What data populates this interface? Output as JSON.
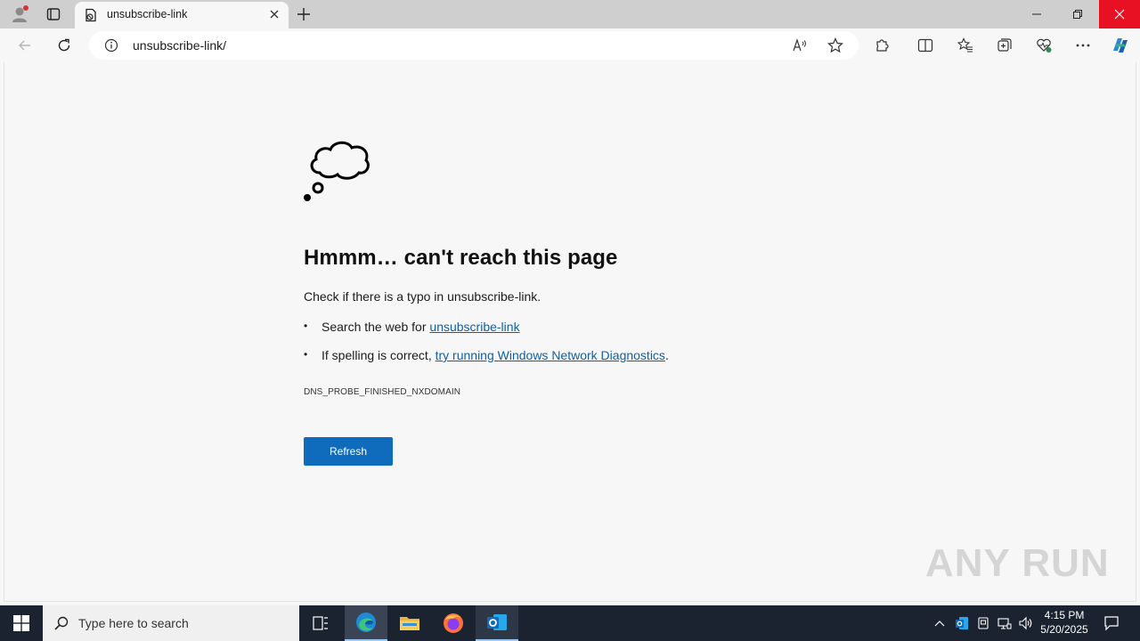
{
  "browser": {
    "tab_title": "unsubscribe-link",
    "url": "unsubscribe-link/"
  },
  "error_page": {
    "heading": "Hmmm… can't reach this page",
    "check_text": "Check if there is a typo in unsubscribe-link.",
    "bullet1_prefix": "Search the web for ",
    "bullet1_link": "unsubscribe-link",
    "bullet2_prefix": "If spelling is correct, ",
    "bullet2_link": "try running Windows Network Diagnostics",
    "bullet2_suffix": ".",
    "error_code": "DNS_PROBE_FINISHED_NXDOMAIN",
    "refresh_label": "Refresh"
  },
  "watermark": "ANY RUN",
  "taskbar": {
    "search_placeholder": "Type here to search",
    "time": "4:15 PM",
    "date": "5/20/2025"
  },
  "colors": {
    "accent": "#0f6cbd",
    "link": "#0f5fa8",
    "close_red": "#e81123",
    "taskbar": "#1b2330"
  }
}
